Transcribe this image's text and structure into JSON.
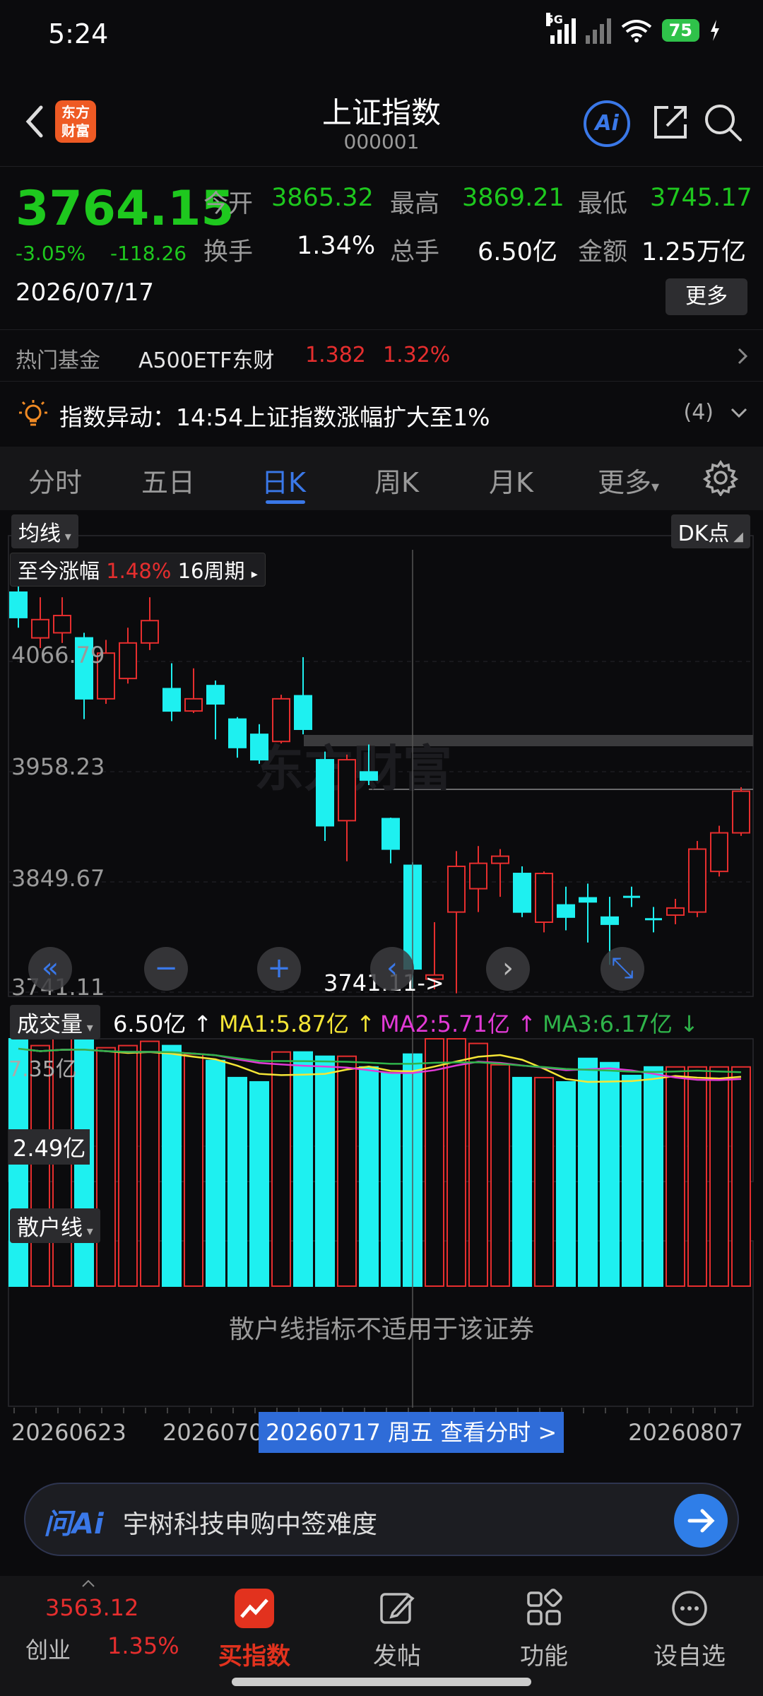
{
  "status": {
    "time": "5:24",
    "network": "5G",
    "battery": "75"
  },
  "header": {
    "logo_text": "东方财富",
    "title": "上证指数",
    "code": "000001",
    "ai_label": "Ai"
  },
  "quote": {
    "price": "3764.15",
    "change_pct": "-3.05%",
    "change": "-118.26",
    "date": "2026/07/17",
    "open_label": "今开",
    "open": "3865.32",
    "high_label": "最高",
    "high": "3869.21",
    "low_label": "最低",
    "low": "3745.17",
    "turnover_label": "换手",
    "turnover": "1.34%",
    "volume_label": "总手",
    "volume": "6.50亿",
    "amount_label": "金额",
    "amount": "1.25万亿",
    "more_label": "更多"
  },
  "fund": {
    "label": "热门基金",
    "name": "A500ETF东财",
    "price": "1.382",
    "pct": "1.32%"
  },
  "alert": {
    "text": "指数异动：14:54上证指数涨幅扩大至1%",
    "count": "(4)"
  },
  "tabs": [
    "分时",
    "五日",
    "日K",
    "周K",
    "月K",
    "更多"
  ],
  "chart": {
    "ma_label": "均线",
    "dk_label": "DK点",
    "range_label": "至今涨幅",
    "range_pct": "1.48%",
    "range_period": "16周期",
    "price_levels": [
      "4066.79",
      "3958.23",
      "3849.67",
      "3741.11"
    ],
    "crosshair_value": "3741.11->",
    "watermark": "东方财富"
  },
  "volume_panel": {
    "label": "成交量",
    "value": "6.50亿 ↑",
    "ma1": "MA1:5.87亿 ↑",
    "ma2": "MA2:5.71亿 ↑",
    "ma3": "MA3:6.17亿 ↓",
    "top_value": "7.35亿",
    "cursor_value": "2.49亿",
    "colors": {
      "ma1": "#f5e636",
      "ma2": "#e23ad6",
      "ma3": "#2fb44a"
    }
  },
  "retail_panel": {
    "label": "散户线",
    "message": "散户线指标不适用于该证券"
  },
  "date_axis": {
    "start": "20260623",
    "mid": "2026070",
    "end": "20260807",
    "selected": "20260717 周五 查看分时 >"
  },
  "ask": {
    "brand": "问Ai",
    "text": "宇树科技申购中签难度"
  },
  "bottom_nav": {
    "index_value": "3563.12",
    "index_name": "创业",
    "index_pct": "1.35%",
    "items": [
      "买指数",
      "发帖",
      "功能",
      "设自选"
    ]
  },
  "chart_data": {
    "type": "candlestick",
    "yaxis_ticks": [
      4066.79,
      3958.23,
      3849.67,
      3741.11
    ],
    "candles": [
      {
        "o": 4135,
        "c": 4110,
        "h": 4150,
        "l": 4100
      },
      {
        "o": 4090,
        "c": 4108,
        "h": 4130,
        "l": 4080
      },
      {
        "o": 4095,
        "c": 4112,
        "h": 4130,
        "l": 4085
      },
      {
        "o": 4090,
        "c": 4030,
        "h": 4095,
        "l": 4010
      },
      {
        "o": 4030,
        "c": 4075,
        "h": 4088,
        "l": 4025
      },
      {
        "o": 4050,
        "c": 4085,
        "h": 4100,
        "l": 4045
      },
      {
        "o": 4085,
        "c": 4107,
        "h": 4130,
        "l": 4078
      },
      {
        "o": 4040,
        "c": 4018,
        "h": 4065,
        "l": 4008
      },
      {
        "o": 4018,
        "c": 4030,
        "h": 4060,
        "l": 4016
      },
      {
        "o": 4043,
        "c": 4025,
        "h": 4048,
        "l": 3990
      },
      {
        "o": 4010,
        "c": 3982,
        "h": 4012,
        "l": 3972
      },
      {
        "o": 3995,
        "c": 3970,
        "h": 4005,
        "l": 3966
      },
      {
        "o": 3988,
        "c": 4030,
        "h": 4034,
        "l": 3986
      },
      {
        "o": 4033,
        "c": 4000,
        "h": 4071,
        "l": 3995
      },
      {
        "o": 3970,
        "c": 3905,
        "h": 3978,
        "l": 3890
      },
      {
        "o": 3910,
        "c": 3970,
        "h": 3975,
        "l": 3870
      },
      {
        "o": 3958,
        "c": 3950,
        "h": 3985,
        "l": 3945
      },
      {
        "o": 3912,
        "c": 3882,
        "h": 3913,
        "l": 3868
      },
      {
        "o": 3866,
        "c": 3764,
        "h": 3869,
        "l": 3745
      },
      {
        "o": 3754,
        "c": 3758,
        "h": 3810,
        "l": 3744
      },
      {
        "o": 3820,
        "c": 3865,
        "h": 3880,
        "l": 3740
      },
      {
        "o": 3843,
        "c": 3868,
        "h": 3885,
        "l": 3820
      },
      {
        "o": 3868,
        "c": 3875,
        "h": 3882,
        "l": 3835
      },
      {
        "o": 3858,
        "c": 3820,
        "h": 3865,
        "l": 3815
      },
      {
        "o": 3810,
        "c": 3858,
        "h": 3860,
        "l": 3800
      },
      {
        "o": 3827,
        "c": 3815,
        "h": 3845,
        "l": 3802
      },
      {
        "o": 3834,
        "c": 3830,
        "h": 3848,
        "l": 3790
      },
      {
        "o": 3815,
        "c": 3808,
        "h": 3835,
        "l": 3768
      },
      {
        "o": 3835,
        "c": 3835,
        "h": 3845,
        "l": 3825
      },
      {
        "o": 3813,
        "c": 3813,
        "h": 3825,
        "l": 3800
      },
      {
        "o": 3817,
        "c": 3824,
        "h": 3833,
        "l": 3808
      },
      {
        "o": 3820,
        "c": 3882,
        "h": 3890,
        "l": 3815
      },
      {
        "o": 3860,
        "c": 3898,
        "h": 3905,
        "l": 3855
      },
      {
        "o": 3898,
        "c": 3939,
        "h": 3943,
        "l": 3895
      }
    ],
    "volumes": [
      7.3,
      6.9,
      7.3,
      7.2,
      6.8,
      6.9,
      7.1,
      6.9,
      6.5,
      6.2,
      5.4,
      5.2,
      6.6,
      6.6,
      6.4,
      6.4,
      5.9,
      5.6,
      6.5,
      7.5,
      7.6,
      7.0,
      6.0,
      5.4,
      5.4,
      5.2,
      6.3,
      6.1,
      5.5,
      5.9,
      5.9,
      5.9,
      5.9,
      5.9
    ]
  }
}
